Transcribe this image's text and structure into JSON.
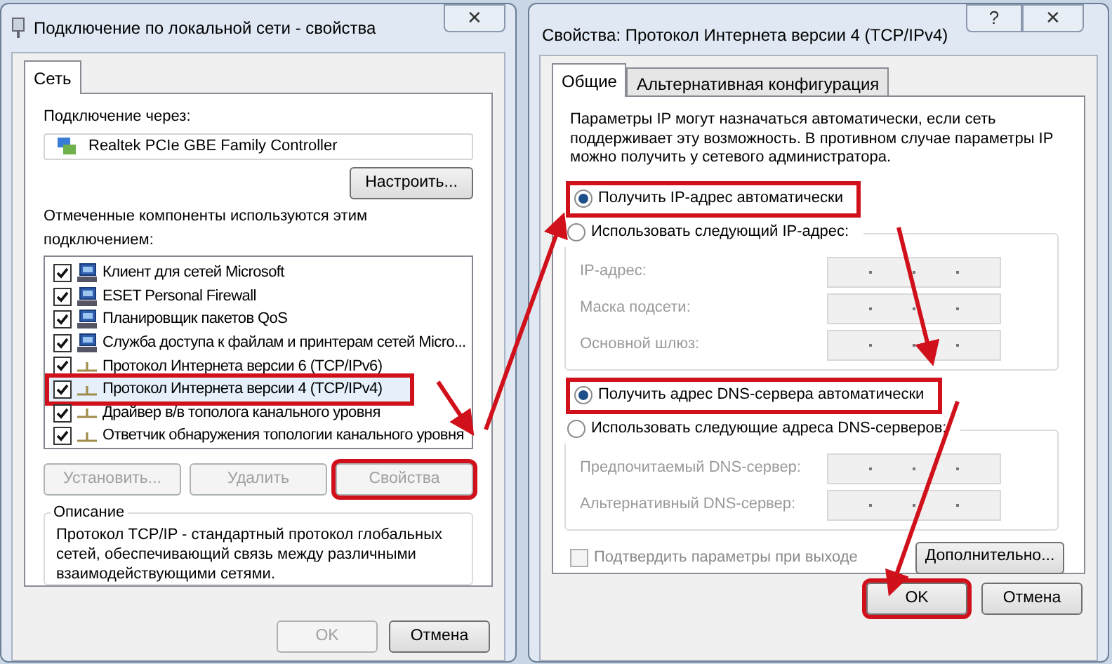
{
  "left_dialog": {
    "title": "Подключение по локальной сети - свойства",
    "close_symbol": "✕",
    "tabs": [
      {
        "label": "Сеть",
        "selected": true
      }
    ],
    "connect_via_label": "Подключение через:",
    "adapter": "Realtek PCIe GBE Family Controller",
    "configure_button": "Настроить...",
    "components_label": "Отмеченные компоненты используются этим подключением:",
    "components": [
      {
        "label": "Клиент для сетей Microsoft",
        "checked": true,
        "selected": false,
        "highlighted": false,
        "kind": "client"
      },
      {
        "label": "ESET Personal Firewall",
        "checked": true,
        "selected": false,
        "highlighted": false,
        "kind": "service"
      },
      {
        "label": "Планировщик пакетов QoS",
        "checked": true,
        "selected": false,
        "highlighted": false,
        "kind": "service"
      },
      {
        "label": "Служба доступа к файлам и принтерам сетей Micro...",
        "checked": true,
        "selected": false,
        "highlighted": false,
        "kind": "service"
      },
      {
        "label": "Протокол Интернета версии 6 (TCP/IPv6)",
        "checked": true,
        "selected": false,
        "highlighted": false,
        "kind": "protocol"
      },
      {
        "label": "Протокол Интернета версии 4 (TCP/IPv4)",
        "checked": true,
        "selected": true,
        "highlighted": true,
        "kind": "protocol"
      },
      {
        "label": "Драйвер в/в тополога канального уровня",
        "checked": true,
        "selected": false,
        "highlighted": false,
        "kind": "protocol"
      },
      {
        "label": "Ответчик обнаружения топологии канального уровня",
        "checked": true,
        "selected": false,
        "highlighted": false,
        "kind": "protocol"
      }
    ],
    "buttons": [
      {
        "label": "Установить...",
        "disabled": true,
        "highlighted": false
      },
      {
        "label": "Удалить",
        "disabled": true,
        "highlighted": false
      },
      {
        "label": "Свойства",
        "disabled": true,
        "highlighted": true
      }
    ],
    "description": {
      "title": "Описание",
      "text": "Протокол TCP/IP - стандартный протокол глобальных сетей, обеспечивающий связь между различными взаимодействующими сетями."
    },
    "footer_buttons": [
      {
        "label": "OK",
        "disabled": true,
        "highlighted": false
      },
      {
        "label": "Отмена",
        "disabled": false,
        "highlighted": false
      }
    ]
  },
  "right_dialog": {
    "title": "Свойства: Протокол Интернета версии 4 (TCP/IPv4)",
    "help_symbol": "?",
    "close_symbol": "✕",
    "tabs": [
      {
        "label": "Общие",
        "selected": true
      },
      {
        "label": "Альтернативная конфигурация",
        "selected": false
      }
    ],
    "intro": "Параметры IP могут назначаться автоматически, если сеть поддерживает эту возможность. В противном случае параметры IP можно получить у сетевого администратора.",
    "ip_options": [
      {
        "label": "Получить IP-адрес автоматически",
        "selected": true,
        "highlighted": true
      },
      {
        "label": "Использовать следующий IP-адрес:",
        "selected": false,
        "highlighted": false
      }
    ],
    "ip_fields": [
      {
        "label": "IP-адрес:",
        "disabled": true
      },
      {
        "label": "Маска подсети:",
        "disabled": true
      },
      {
        "label": "Основной шлюз:",
        "disabled": true
      }
    ],
    "dns_options": [
      {
        "label": "Получить адрес DNS-сервера автоматически",
        "selected": true,
        "highlighted": true
      },
      {
        "label": "Использовать следующие адреса DNS-серверов:",
        "selected": false,
        "highlighted": false
      }
    ],
    "dns_fields": [
      {
        "label": "Предпочитаемый DNS-сервер:",
        "disabled": true
      },
      {
        "label": "Альтернативный DNS-сервер:",
        "disabled": true
      }
    ],
    "validate": {
      "label": "Подтвердить параметры при выходе",
      "checked": false,
      "disabled": true
    },
    "advanced_button": "Дополнительно...",
    "footer_buttons": [
      {
        "label": "OK",
        "disabled": false,
        "highlighted": true
      },
      {
        "label": "Отмена",
        "disabled": false,
        "highlighted": false
      }
    ]
  }
}
